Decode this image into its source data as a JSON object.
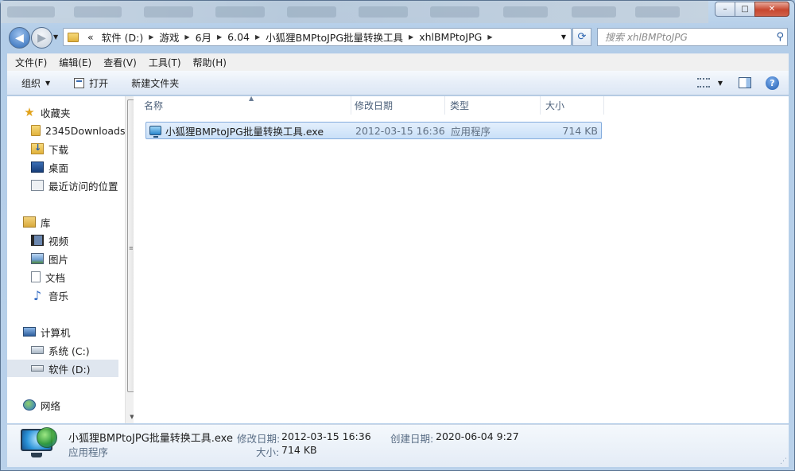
{
  "window": {
    "controls": {
      "minimize": "–",
      "maximize": "□",
      "close": "✕"
    }
  },
  "address": {
    "overflow": "«",
    "crumbs": [
      "软件 (D:)",
      "游戏",
      "6月",
      "6.04",
      "小狐狸BMPtoJPG批量转换工具",
      "xhlBMPtoJPG"
    ]
  },
  "search": {
    "placeholder": "搜索 xhlBMPtoJPG"
  },
  "menu": [
    "文件(F)",
    "编辑(E)",
    "查看(V)",
    "工具(T)",
    "帮助(H)"
  ],
  "toolbar": {
    "organize": "组织",
    "open": "打开",
    "new_folder": "新建文件夹"
  },
  "nav": {
    "favorites": "收藏夹",
    "fav_items": [
      "2345Downloads",
      "下载",
      "桌面",
      "最近访问的位置"
    ],
    "libraries": "库",
    "lib_items": [
      "视频",
      "图片",
      "文档",
      "音乐"
    ],
    "computer": "计算机",
    "comp_items": [
      "系统 (C:)",
      "软件 (D:)"
    ],
    "network": "网络"
  },
  "columns": {
    "name": "名称",
    "modified": "修改日期",
    "type": "类型",
    "size": "大小"
  },
  "files": [
    {
      "name": "小狐狸BMPtoJPG批量转换工具.exe",
      "modified": "2012-03-15 16:36",
      "type": "应用程序",
      "size": "714 KB"
    }
  ],
  "details": {
    "name": "小狐狸BMPtoJPG批量转换工具.exe",
    "type": "应用程序",
    "modified_label": "修改日期:",
    "modified": "2012-03-15 16:36",
    "created_label": "创建日期:",
    "created": "2020-06-04 9:27",
    "size_label": "大小:",
    "size": "714 KB"
  },
  "colors": {
    "selection": "#cde4fb",
    "accent": "#2c64b0"
  }
}
